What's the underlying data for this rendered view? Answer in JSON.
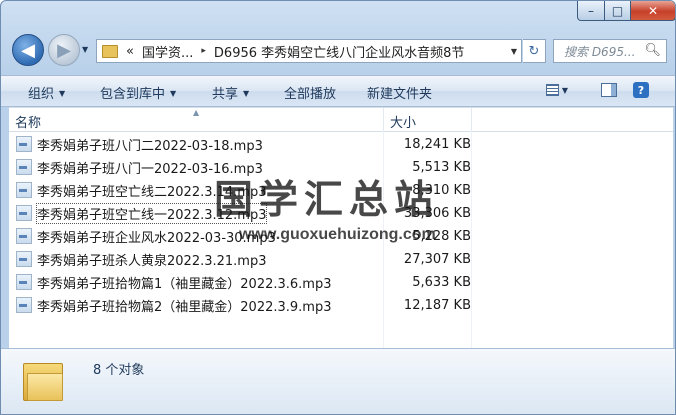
{
  "window": {
    "controls": {
      "minimize": "–",
      "maximize": "□",
      "close": "✕"
    }
  },
  "nav": {
    "back_glyph": "◀",
    "forward_glyph": "▶",
    "dropdown_glyph": "▼"
  },
  "address": {
    "overflow": "«",
    "crumbs": [
      "国学资...",
      "D6956 李秀娟空亡线八门企业风水音频8节"
    ],
    "separator": "▸",
    "dropdown": "▼",
    "refresh": "↻"
  },
  "search": {
    "placeholder": "搜索 D695...",
    "icon": "search-icon"
  },
  "toolbar": {
    "organize": "组织",
    "include_library": "包含到库中",
    "share": "共享",
    "play_all": "全部播放",
    "new_folder": "新建文件夹",
    "help": "?"
  },
  "columns": {
    "name": "名称",
    "size": "大小"
  },
  "files": [
    {
      "name": "李秀娟弟子班八门二2022-03-18.mp3",
      "size": "18,241 KB"
    },
    {
      "name": "李秀娟弟子班八门一2022-03-16.mp3",
      "size": "5,513 KB"
    },
    {
      "name": "李秀娟弟子班空亡线二2022.3.14.mp3",
      "size": "8,310 KB"
    },
    {
      "name": "李秀娟弟子班空亡线一2022.3.12.mp3",
      "size": "33,306 KB"
    },
    {
      "name": "李秀娟弟子班企业风水2022-03-30.mp3",
      "size": "5,228 KB"
    },
    {
      "name": "李秀娟弟子班杀人黄泉2022.3.21.mp3",
      "size": "27,307 KB"
    },
    {
      "name": "李秀娟弟子班拾物篇1（袖里藏金）2022.3.6.mp3",
      "size": "5,633 KB"
    },
    {
      "name": "李秀娟弟子班拾物篇2（袖里藏金）2022.3.9.mp3",
      "size": "12,187 KB"
    }
  ],
  "watermark": {
    "title": "国学汇总站",
    "url": "www.guoxuehuizong.com"
  },
  "status": {
    "count": "8 个对象"
  }
}
